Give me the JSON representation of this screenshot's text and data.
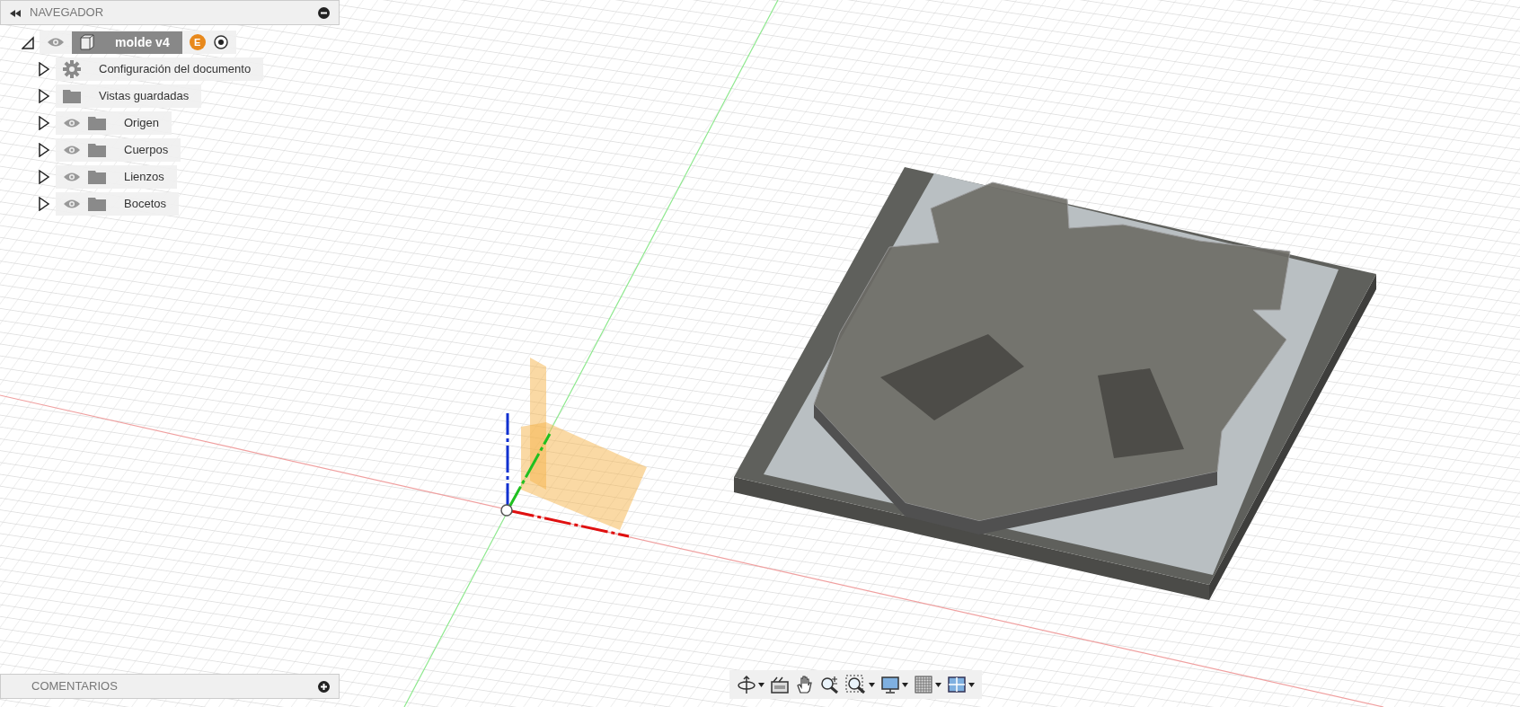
{
  "navigator": {
    "title": "NAVEGADOR",
    "tree": {
      "label": "molde v4",
      "expanded": true,
      "visibility_toggle": true,
      "badge": "E",
      "active": true,
      "children": [
        {
          "label": "Configuración del documento",
          "kind": "gear",
          "expanded": false,
          "visibility_toggle": false
        },
        {
          "label": "Vistas guardadas",
          "kind": "folder",
          "expanded": false,
          "visibility_toggle": false
        },
        {
          "label": "Origen",
          "kind": "folder",
          "expanded": false,
          "visibility_toggle": true
        },
        {
          "label": "Cuerpos",
          "kind": "folder",
          "expanded": false,
          "visibility_toggle": true
        },
        {
          "label": "Lienzos",
          "kind": "folder",
          "expanded": false,
          "visibility_toggle": true
        },
        {
          "label": "Bocetos",
          "kind": "folder",
          "expanded": false,
          "visibility_toggle": true
        }
      ]
    }
  },
  "comments": {
    "title": "COMENTARIOS"
  },
  "toolbar": [
    {
      "kind": "orbit",
      "dropdown": true
    },
    {
      "kind": "look-at",
      "dropdown": false
    },
    {
      "kind": "pan",
      "dropdown": false
    },
    {
      "kind": "zoom",
      "dropdown": false
    },
    {
      "kind": "fit",
      "dropdown": true
    },
    {
      "kind": "display",
      "dropdown": true
    },
    {
      "kind": "grid",
      "dropdown": true
    },
    {
      "kind": "viewports",
      "dropdown": true
    }
  ]
}
